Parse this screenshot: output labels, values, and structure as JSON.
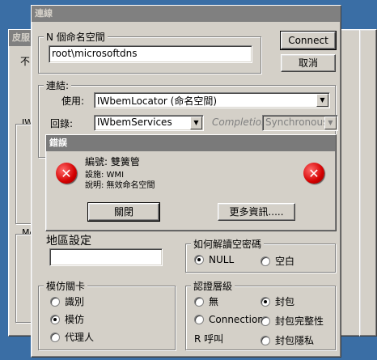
{
  "background_window": {
    "title": "皮服",
    "label_not": "不",
    "label_iw": "IWbe",
    "label_me": "Me"
  },
  "dialog": {
    "title": "連線",
    "namespace_label": "N 個命名空間",
    "namespace_value": "root\\microsoftdns",
    "connect_button": "Connect",
    "cancel_button": "取消",
    "connection_group": "連結:",
    "using_label": "使用:",
    "using_value": "IWbemLocator (命名空間)",
    "return_label": "回錄:",
    "return_value": "IWbemServices",
    "completion_label": "Completion:",
    "completion_value": "Synchronous",
    "locale_group": "地區設定",
    "locale_value": "",
    "auth_group": "如何解讀空密碼",
    "auth_null": "NULL",
    "auth_blank": "空白",
    "impersonation_group": "模仿關卡",
    "imp_identify": "識別",
    "imp_impersonate": "模仿",
    "imp_delegate": "代理人",
    "auth_level_group": "認證層級",
    "lvl_none": "無",
    "lvl_packet": "封包",
    "lvl_connection": "Connection",
    "lvl_integrity": "封包完整性",
    "lvl_call": "R 呼叫",
    "lvl_privacy": "封包隱私"
  },
  "error": {
    "title": "錯誤",
    "line1": "編號: 雙簧管",
    "line2": "設施: WMI",
    "line3": "說明: 無效命名空間",
    "close_button": "關閉",
    "more_button": "更多資訊....."
  },
  "colors": {
    "desktop": "#3a6ea5",
    "face": "#d4d0c8",
    "error_red": "#d40000"
  }
}
